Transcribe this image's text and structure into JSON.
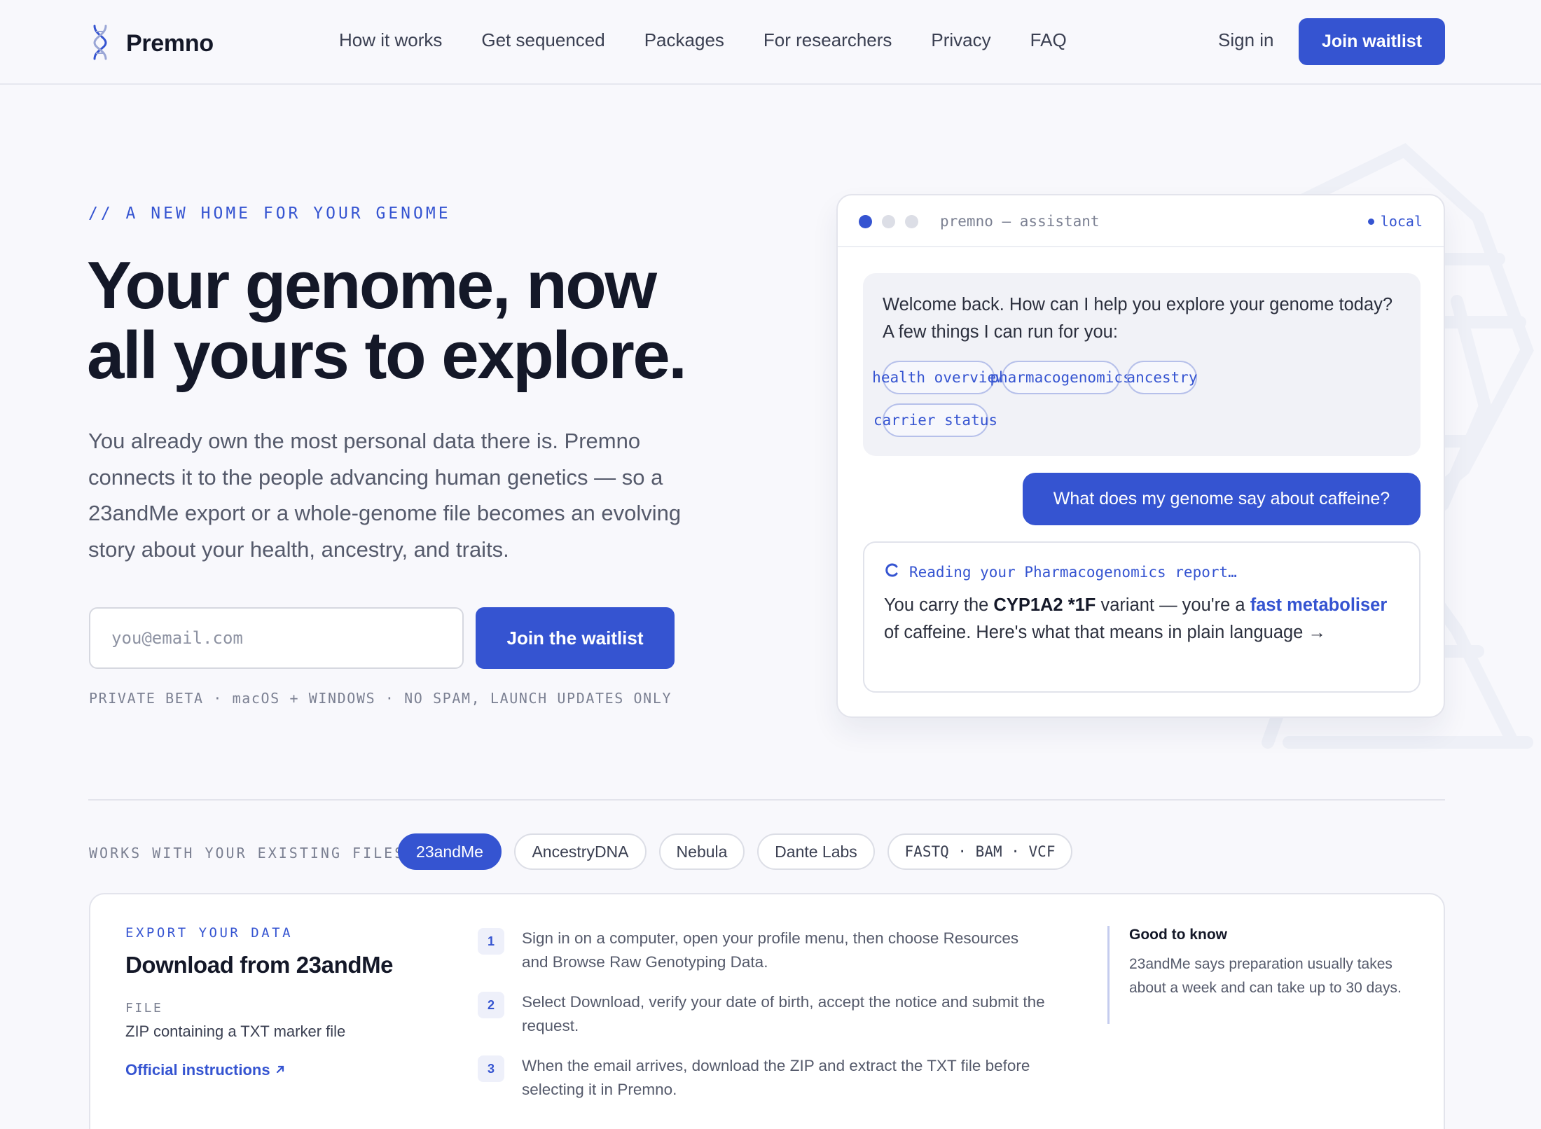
{
  "brand": {
    "name": "Premno",
    "logo_icon": "dna-helix-icon"
  },
  "nav": {
    "links": [
      "How it works",
      "Get sequenced",
      "Packages",
      "For researchers",
      "Privacy",
      "FAQ"
    ],
    "sign_in": "Sign in",
    "cta": "Join waitlist"
  },
  "hero": {
    "eyebrow": "// A NEW HOME FOR YOUR GENOME",
    "headline_line1": "Your genome, now",
    "headline_line2": "all yours to explore.",
    "lede": "You already own the most personal data there is. Premno connects it to the people advancing human genetics — so a 23andMe export or a whole-genome file becomes an evolving story about your health, ancestry, and traits.",
    "email_placeholder": "you@email.com",
    "email_value": "",
    "cta": "Join the waitlist",
    "fineprint": "PRIVATE BETA · macOS + WINDOWS · NO SPAM, LAUNCH UPDATES ONLY"
  },
  "assistant": {
    "title": "premno — assistant",
    "status": "local",
    "welcome": "Welcome back. How can I help you explore your genome today? A few things I can run for you:",
    "chips": [
      "health overview",
      "pharmacogenomics",
      "ancestry",
      "carrier status"
    ],
    "user_message": "What does my genome say about caffeine?",
    "reading_status": "Reading your Pharmacogenomics report…",
    "reply_pre": "You carry the ",
    "reply_variant": "CYP1A2 *1F",
    "reply_mid": " variant — you're a ",
    "reply_accent": "fast metaboliser",
    "reply_post": " of caffeine. Here's what that means in plain language →"
  },
  "sources": {
    "label": "WORKS WITH YOUR EXISTING FILES",
    "tabs": [
      "23andMe",
      "AncestryDNA",
      "Nebula",
      "Dante Labs",
      "FASTQ · BAM · VCF"
    ],
    "active_index": 0
  },
  "export": {
    "eyebrow": "EXPORT YOUR DATA",
    "title": "Download from 23andMe",
    "file_label": "FILE",
    "file_value": "ZIP containing a TXT marker file",
    "link": "Official instructions",
    "steps": [
      {
        "num": "1",
        "text": "Sign in on a computer, open your profile menu, then choose Resources and Browse Raw Genotyping Data."
      },
      {
        "num": "2",
        "text": "Select Download, verify your date of birth, accept the notice and submit the request."
      },
      {
        "num": "3",
        "text": "When the email arrives, download the ZIP and extract the TXT file before selecting it in Premno."
      }
    ],
    "good_title": "Good to know",
    "good_text": "23andMe says preparation usually takes about a week and can take up to 30 days."
  },
  "colors": {
    "accent": "#3554d1",
    "background": "#f8f8fc",
    "text": "#141828"
  }
}
